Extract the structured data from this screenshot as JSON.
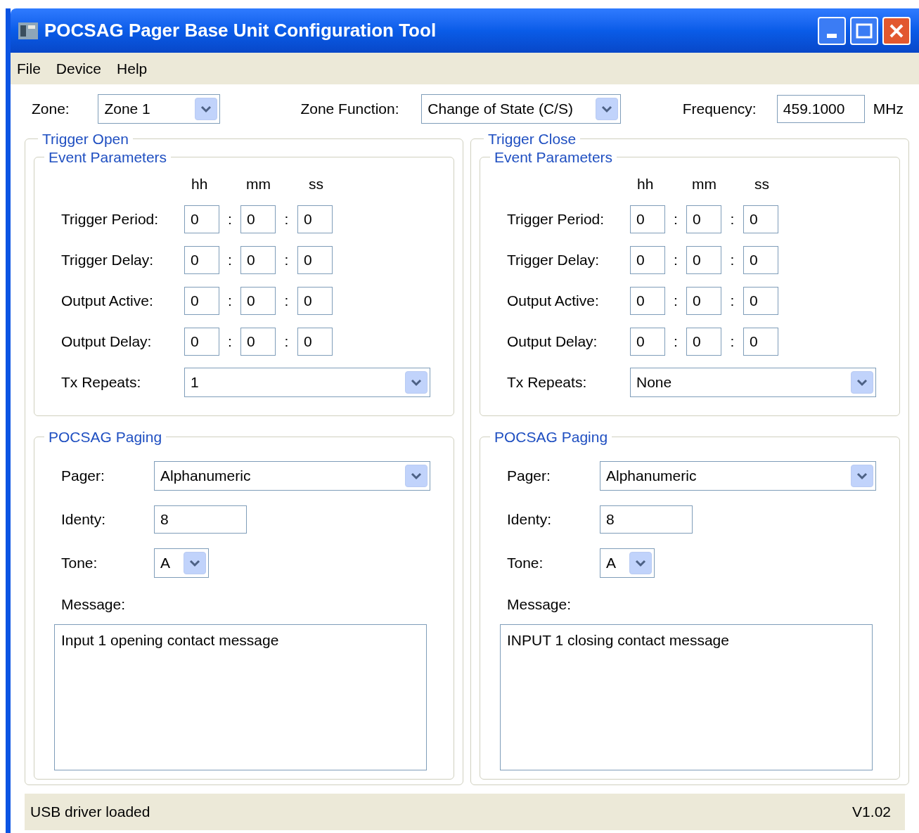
{
  "window": {
    "title": "POCSAG Pager Base Unit Configuration Tool"
  },
  "menu": [
    "File",
    "Device",
    "Help"
  ],
  "settings": {
    "zone": {
      "label": "Zone:",
      "value": "Zone 1"
    },
    "zone_function": {
      "label": "Zone Function:",
      "value": "Change of State (C/S)"
    },
    "frequency": {
      "label": "Frequency:",
      "value": "459.1000",
      "unit": "MHz"
    }
  },
  "panels": [
    {
      "title": "Trigger Open",
      "event": {
        "title": "Event Parameters",
        "headers": [
          "hh",
          "mm",
          "ss"
        ],
        "rows": [
          {
            "label": "Trigger Period:",
            "hh": "0",
            "mm": "0",
            "ss": "0",
            "separators": [
              ":",
              ":"
            ]
          },
          {
            "label": "Trigger Delay:",
            "hh": "0",
            "mm": "0",
            "ss": "0",
            "separators": [
              ":",
              ":"
            ]
          },
          {
            "label": "Output Active:",
            "hh": "0",
            "mm": "0",
            "ss": "0",
            "separators": [
              ":",
              ":"
            ]
          },
          {
            "label": "Output Delay:",
            "hh": "0",
            "mm": "0",
            "ss": "0",
            "separators": [
              ":",
              ":"
            ]
          }
        ],
        "tx_repeats": {
          "label": "Tx Repeats:",
          "value": "1"
        }
      },
      "paging": {
        "title": "POCSAG Paging",
        "pager": {
          "label": "Pager:",
          "value": "Alphanumeric"
        },
        "identy": {
          "label": "Identy:",
          "value": "8"
        },
        "tone": {
          "label": "Tone:",
          "value": "A"
        },
        "message_label": "Message:",
        "message": "Input 1 opening contact message"
      }
    },
    {
      "title": "Trigger Close",
      "event": {
        "title": "Event Parameters",
        "headers": [
          "hh",
          "mm",
          "ss"
        ],
        "rows": [
          {
            "label": "Trigger Period:",
            "hh": "0",
            "mm": "0",
            "ss": "0",
            "separators": [
              ":",
              ":"
            ]
          },
          {
            "label": "Trigger Delay:",
            "hh": "0",
            "mm": "0",
            "ss": "0",
            "separators": [
              ":",
              ":"
            ]
          },
          {
            "label": "Output Active:",
            "hh": "0",
            "mm": "0",
            "ss": "0",
            "separators": [
              ":",
              ":"
            ]
          },
          {
            "label": "Output Delay:",
            "hh": "0",
            "mm": "0",
            "ss": "0",
            "separators": [
              ":",
              ":"
            ]
          }
        ],
        "tx_repeats": {
          "label": "Tx Repeats:",
          "value": "None"
        }
      },
      "paging": {
        "title": "POCSAG Paging",
        "pager": {
          "label": "Pager:",
          "value": "Alphanumeric"
        },
        "identy": {
          "label": "Identy:",
          "value": "8"
        },
        "tone": {
          "label": "Tone:",
          "value": "A"
        },
        "message_label": "Message:",
        "message": "INPUT 1 closing contact message"
      }
    }
  ],
  "status_bar": {
    "text": "USB driver loaded",
    "version": "V1.02"
  }
}
